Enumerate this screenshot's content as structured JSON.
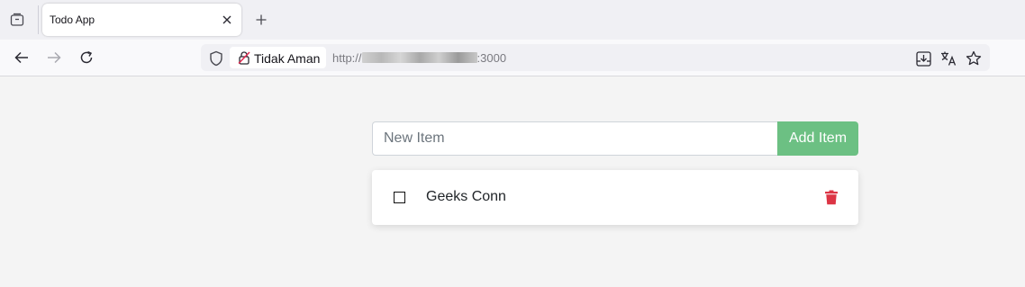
{
  "browser": {
    "tab": {
      "title": "Todo App"
    },
    "security_label": "Tidak Aman",
    "url_prefix": "http://",
    "url_suffix": ":3000"
  },
  "todo": {
    "input_placeholder": "New Item",
    "add_button_label": "Add Item",
    "items": [
      {
        "name": "Geeks Conn",
        "completed": false
      }
    ]
  },
  "colors": {
    "add_button": "#6cc083",
    "delete_icon": "#dc3545"
  }
}
